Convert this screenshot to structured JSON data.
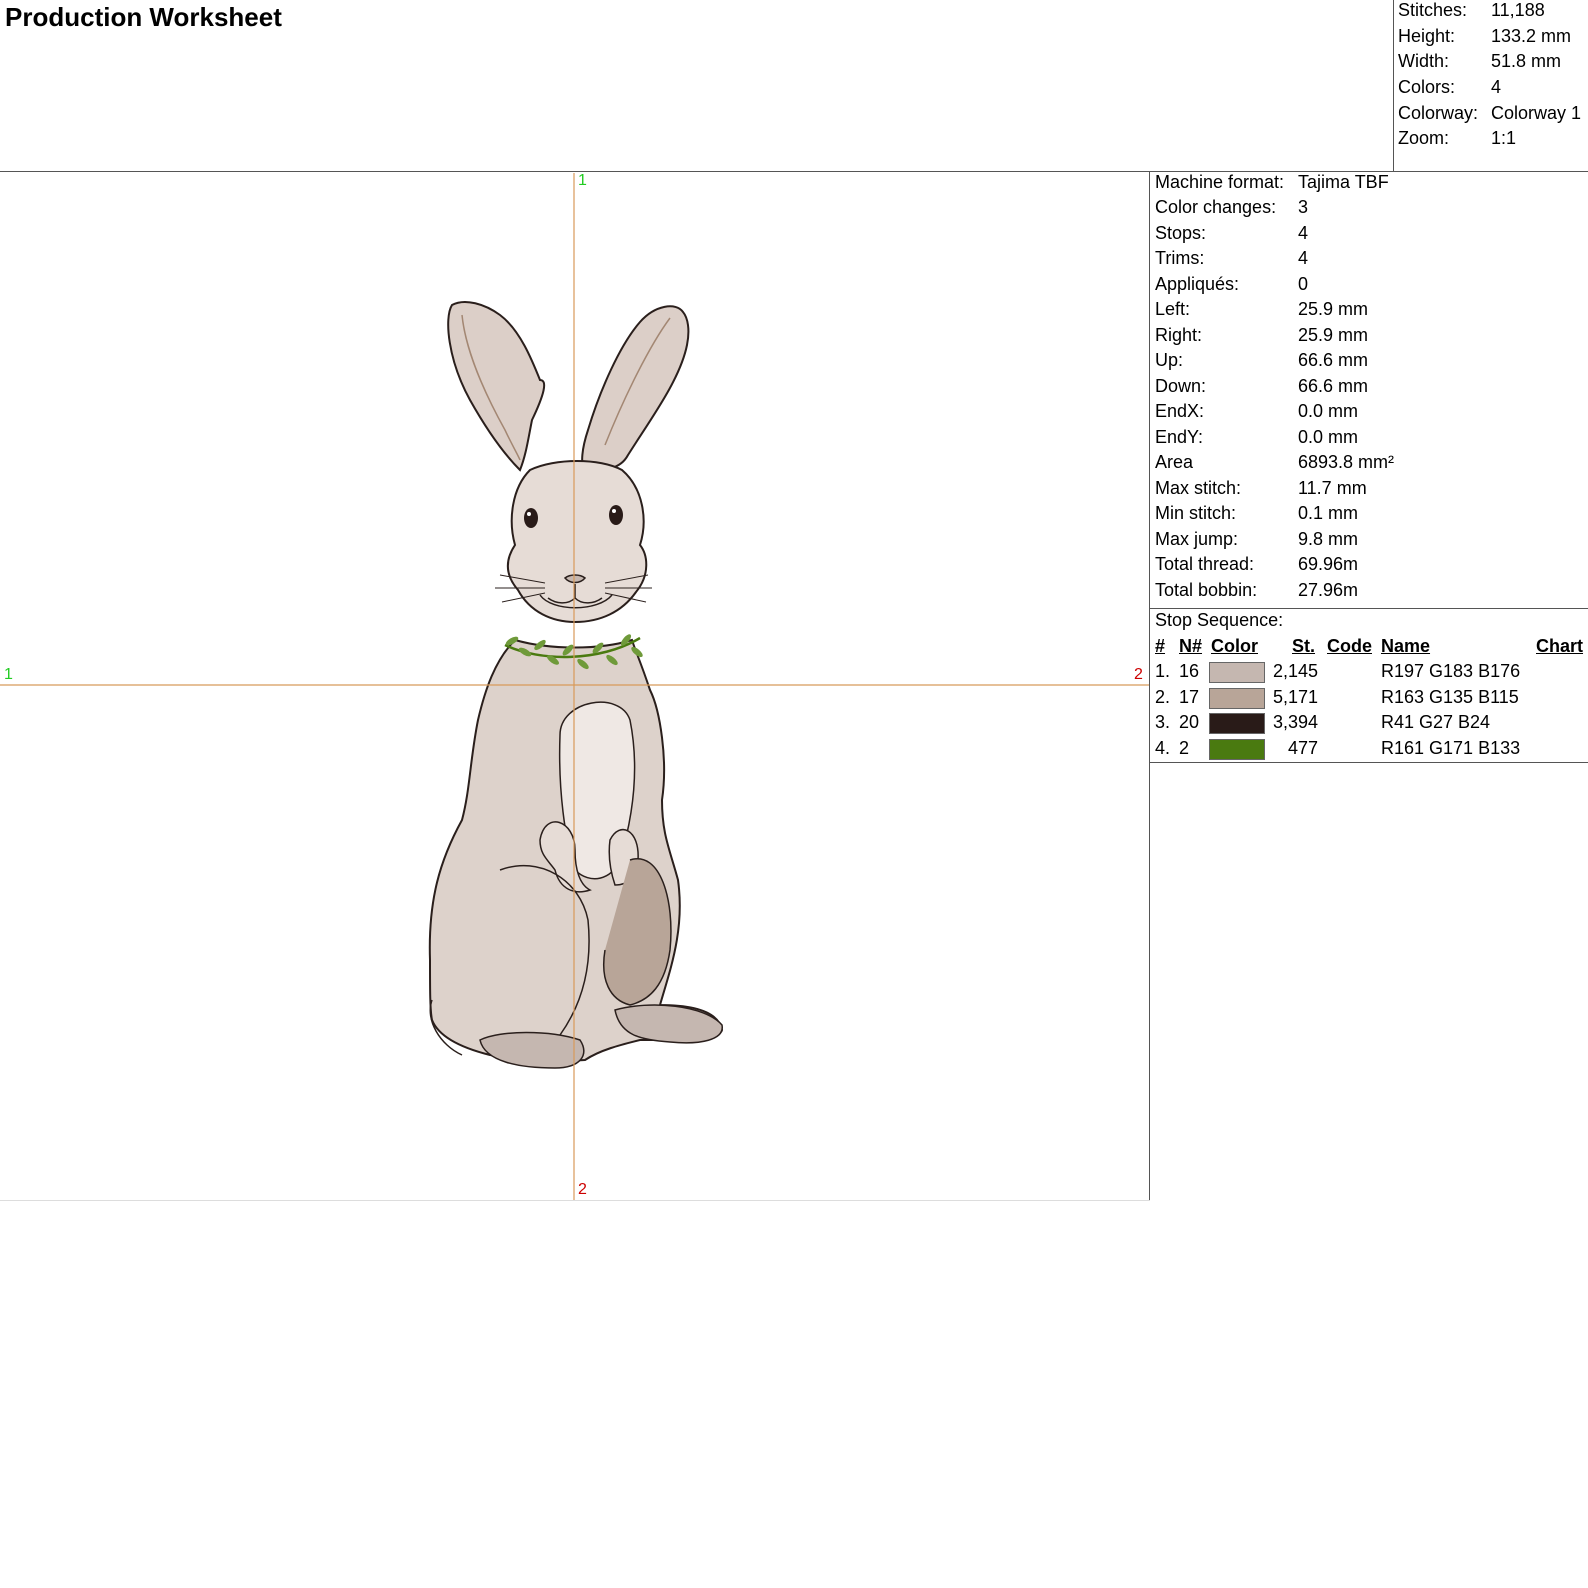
{
  "title": "Production Worksheet",
  "summary": [
    {
      "label": "Stitches:",
      "value": "11,188"
    },
    {
      "label": "Height:",
      "value": "133.2 mm"
    },
    {
      "label": "Width:",
      "value": "51.8 mm"
    },
    {
      "label": "Colors:",
      "value": "4"
    },
    {
      "label": "Colorway:",
      "value": "Colorway 1"
    },
    {
      "label": "Zoom:",
      "value": "1:1"
    }
  ],
  "details": [
    {
      "label": "Machine format:",
      "value": "Tajima TBF"
    },
    {
      "label": "Color changes:",
      "value": "3"
    },
    {
      "label": "Stops:",
      "value": "4"
    },
    {
      "label": "Trims:",
      "value": "4"
    },
    {
      "label": "Appliqués:",
      "value": "0"
    },
    {
      "label": "Left:",
      "value": "25.9 mm"
    },
    {
      "label": "Right:",
      "value": "25.9 mm"
    },
    {
      "label": "Up:",
      "value": "66.6 mm"
    },
    {
      "label": "Down:",
      "value": "66.6 mm"
    },
    {
      "label": "EndX:",
      "value": "0.0 mm"
    },
    {
      "label": "EndY:",
      "value": "0.0 mm"
    },
    {
      "label": "Area",
      "value": "6893.8 mm²"
    },
    {
      "label": "Max stitch:",
      "value": "11.7 mm"
    },
    {
      "label": "Min stitch:",
      "value": "0.1 mm"
    },
    {
      "label": "Max jump:",
      "value": "9.8 mm"
    },
    {
      "label": "Total thread:",
      "value": "69.96m"
    },
    {
      "label": "Total bobbin:",
      "value": "27.96m"
    }
  ],
  "stop_sequence": {
    "heading": "Stop Sequence:",
    "columns": {
      "num": "#",
      "n": "N#",
      "color": "Color",
      "st": "St.",
      "code": "Code",
      "name": "Name",
      "chart": "Chart"
    },
    "rows": [
      {
        "num": "1.",
        "n": "16",
        "swatch": "#c5b7b0",
        "st": "2,145",
        "code": "",
        "name": "R197 G183 B176"
      },
      {
        "num": "2.",
        "n": "17",
        "swatch": "#a38773",
        "st": "5,171",
        "code": "",
        "name": "R163 G135 B115"
      },
      {
        "num": "3.",
        "n": "20",
        "swatch": "#291b18",
        "st": "3,394",
        "code": "",
        "name": "R41 G27 B24"
      },
      {
        "num": "4.",
        "n": "2",
        "swatch": "#4a7a10",
        "st": "477",
        "code": "",
        "name": "R161 G171 B133"
      }
    ]
  },
  "markers": {
    "top": "1",
    "bottom": "2",
    "left": "1",
    "right": "2"
  },
  "colors": {
    "guide": "#d89a5a",
    "marker_start": "#22cc22",
    "marker_end": "#cc0000"
  }
}
